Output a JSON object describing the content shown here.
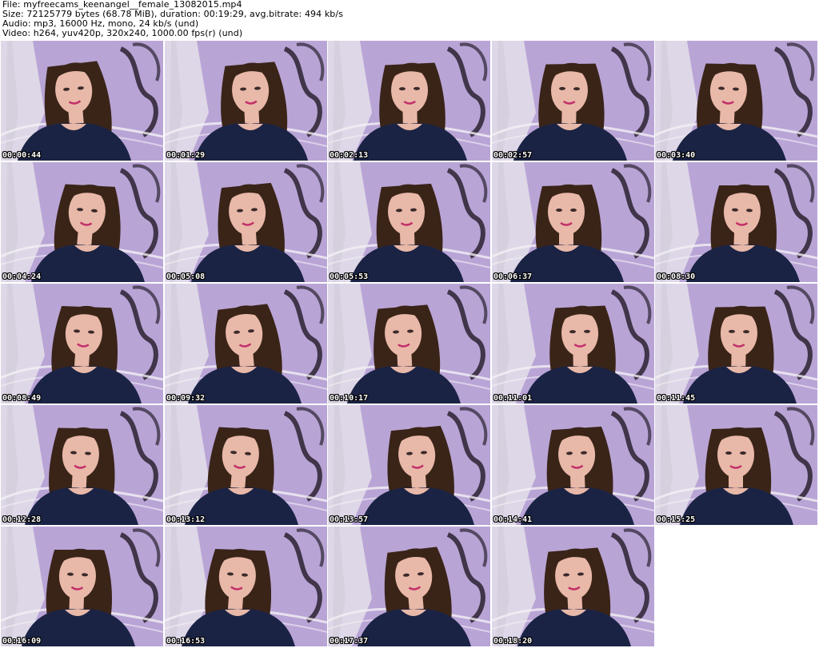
{
  "header": {
    "file_line": "File: myfreecams_keenangel__female_13082015.mp4",
    "size_line": "Size: 72125779 bytes (68.78 MiB), duration: 00:19:29, avg.bitrate: 494 kb/s",
    "audio_line": "Audio: mp3, 16000 Hz, mono, 24 kb/s (und)",
    "video_line": "Video: h264, yuv420p, 320x240, 1000.00 fps(r) (und)"
  },
  "thumbnails": [
    {
      "timestamp": "00:00:44"
    },
    {
      "timestamp": "00:01:29"
    },
    {
      "timestamp": "00:02:13"
    },
    {
      "timestamp": "00:02:57"
    },
    {
      "timestamp": "00:03:40"
    },
    {
      "timestamp": "00:04:24"
    },
    {
      "timestamp": "00:05:08"
    },
    {
      "timestamp": "00:05:53"
    },
    {
      "timestamp": "00:06:37"
    },
    {
      "timestamp": "00:08:30"
    },
    {
      "timestamp": "00:08:49"
    },
    {
      "timestamp": "00:09:32"
    },
    {
      "timestamp": "00:10:17"
    },
    {
      "timestamp": "00:11:01"
    },
    {
      "timestamp": "00:11:45"
    },
    {
      "timestamp": "00:12:28"
    },
    {
      "timestamp": "00:13:12"
    },
    {
      "timestamp": "00:13:57"
    },
    {
      "timestamp": "00:14:41"
    },
    {
      "timestamp": "00:15:25"
    },
    {
      "timestamp": "00:16:09"
    },
    {
      "timestamp": "00:16:53"
    },
    {
      "timestamp": "00:17:37"
    },
    {
      "timestamp": "00:18:20"
    }
  ],
  "colors": {
    "wall": "#b9a4d6",
    "curtain": "#e4e0ea",
    "shirt": "#1a2344",
    "hair": "#3a2418",
    "skin": "#e8b8a8",
    "timestamp_text": "#ffffff"
  }
}
